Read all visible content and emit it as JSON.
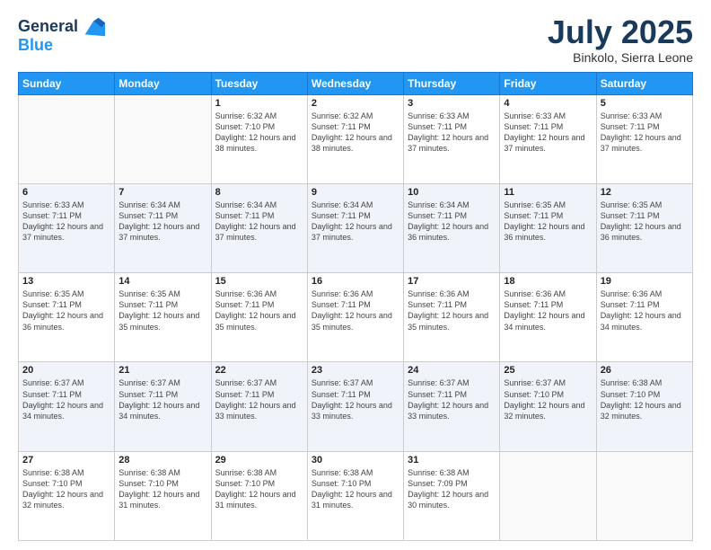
{
  "header": {
    "logo_line1": "General",
    "logo_line2": "Blue",
    "month": "July 2025",
    "location": "Binkolo, Sierra Leone"
  },
  "weekdays": [
    "Sunday",
    "Monday",
    "Tuesday",
    "Wednesday",
    "Thursday",
    "Friday",
    "Saturday"
  ],
  "weeks": [
    [
      {
        "day": "",
        "sunrise": "",
        "sunset": "",
        "daylight": ""
      },
      {
        "day": "",
        "sunrise": "",
        "sunset": "",
        "daylight": ""
      },
      {
        "day": "1",
        "sunrise": "Sunrise: 6:32 AM",
        "sunset": "Sunset: 7:10 PM",
        "daylight": "Daylight: 12 hours and 38 minutes."
      },
      {
        "day": "2",
        "sunrise": "Sunrise: 6:32 AM",
        "sunset": "Sunset: 7:11 PM",
        "daylight": "Daylight: 12 hours and 38 minutes."
      },
      {
        "day": "3",
        "sunrise": "Sunrise: 6:33 AM",
        "sunset": "Sunset: 7:11 PM",
        "daylight": "Daylight: 12 hours and 37 minutes."
      },
      {
        "day": "4",
        "sunrise": "Sunrise: 6:33 AM",
        "sunset": "Sunset: 7:11 PM",
        "daylight": "Daylight: 12 hours and 37 minutes."
      },
      {
        "day": "5",
        "sunrise": "Sunrise: 6:33 AM",
        "sunset": "Sunset: 7:11 PM",
        "daylight": "Daylight: 12 hours and 37 minutes."
      }
    ],
    [
      {
        "day": "6",
        "sunrise": "Sunrise: 6:33 AM",
        "sunset": "Sunset: 7:11 PM",
        "daylight": "Daylight: 12 hours and 37 minutes."
      },
      {
        "day": "7",
        "sunrise": "Sunrise: 6:34 AM",
        "sunset": "Sunset: 7:11 PM",
        "daylight": "Daylight: 12 hours and 37 minutes."
      },
      {
        "day": "8",
        "sunrise": "Sunrise: 6:34 AM",
        "sunset": "Sunset: 7:11 PM",
        "daylight": "Daylight: 12 hours and 37 minutes."
      },
      {
        "day": "9",
        "sunrise": "Sunrise: 6:34 AM",
        "sunset": "Sunset: 7:11 PM",
        "daylight": "Daylight: 12 hours and 37 minutes."
      },
      {
        "day": "10",
        "sunrise": "Sunrise: 6:34 AM",
        "sunset": "Sunset: 7:11 PM",
        "daylight": "Daylight: 12 hours and 36 minutes."
      },
      {
        "day": "11",
        "sunrise": "Sunrise: 6:35 AM",
        "sunset": "Sunset: 7:11 PM",
        "daylight": "Daylight: 12 hours and 36 minutes."
      },
      {
        "day": "12",
        "sunrise": "Sunrise: 6:35 AM",
        "sunset": "Sunset: 7:11 PM",
        "daylight": "Daylight: 12 hours and 36 minutes."
      }
    ],
    [
      {
        "day": "13",
        "sunrise": "Sunrise: 6:35 AM",
        "sunset": "Sunset: 7:11 PM",
        "daylight": "Daylight: 12 hours and 36 minutes."
      },
      {
        "day": "14",
        "sunrise": "Sunrise: 6:35 AM",
        "sunset": "Sunset: 7:11 PM",
        "daylight": "Daylight: 12 hours and 35 minutes."
      },
      {
        "day": "15",
        "sunrise": "Sunrise: 6:36 AM",
        "sunset": "Sunset: 7:11 PM",
        "daylight": "Daylight: 12 hours and 35 minutes."
      },
      {
        "day": "16",
        "sunrise": "Sunrise: 6:36 AM",
        "sunset": "Sunset: 7:11 PM",
        "daylight": "Daylight: 12 hours and 35 minutes."
      },
      {
        "day": "17",
        "sunrise": "Sunrise: 6:36 AM",
        "sunset": "Sunset: 7:11 PM",
        "daylight": "Daylight: 12 hours and 35 minutes."
      },
      {
        "day": "18",
        "sunrise": "Sunrise: 6:36 AM",
        "sunset": "Sunset: 7:11 PM",
        "daylight": "Daylight: 12 hours and 34 minutes."
      },
      {
        "day": "19",
        "sunrise": "Sunrise: 6:36 AM",
        "sunset": "Sunset: 7:11 PM",
        "daylight": "Daylight: 12 hours and 34 minutes."
      }
    ],
    [
      {
        "day": "20",
        "sunrise": "Sunrise: 6:37 AM",
        "sunset": "Sunset: 7:11 PM",
        "daylight": "Daylight: 12 hours and 34 minutes."
      },
      {
        "day": "21",
        "sunrise": "Sunrise: 6:37 AM",
        "sunset": "Sunset: 7:11 PM",
        "daylight": "Daylight: 12 hours and 34 minutes."
      },
      {
        "day": "22",
        "sunrise": "Sunrise: 6:37 AM",
        "sunset": "Sunset: 7:11 PM",
        "daylight": "Daylight: 12 hours and 33 minutes."
      },
      {
        "day": "23",
        "sunrise": "Sunrise: 6:37 AM",
        "sunset": "Sunset: 7:11 PM",
        "daylight": "Daylight: 12 hours and 33 minutes."
      },
      {
        "day": "24",
        "sunrise": "Sunrise: 6:37 AM",
        "sunset": "Sunset: 7:11 PM",
        "daylight": "Daylight: 12 hours and 33 minutes."
      },
      {
        "day": "25",
        "sunrise": "Sunrise: 6:37 AM",
        "sunset": "Sunset: 7:10 PM",
        "daylight": "Daylight: 12 hours and 32 minutes."
      },
      {
        "day": "26",
        "sunrise": "Sunrise: 6:38 AM",
        "sunset": "Sunset: 7:10 PM",
        "daylight": "Daylight: 12 hours and 32 minutes."
      }
    ],
    [
      {
        "day": "27",
        "sunrise": "Sunrise: 6:38 AM",
        "sunset": "Sunset: 7:10 PM",
        "daylight": "Daylight: 12 hours and 32 minutes."
      },
      {
        "day": "28",
        "sunrise": "Sunrise: 6:38 AM",
        "sunset": "Sunset: 7:10 PM",
        "daylight": "Daylight: 12 hours and 31 minutes."
      },
      {
        "day": "29",
        "sunrise": "Sunrise: 6:38 AM",
        "sunset": "Sunset: 7:10 PM",
        "daylight": "Daylight: 12 hours and 31 minutes."
      },
      {
        "day": "30",
        "sunrise": "Sunrise: 6:38 AM",
        "sunset": "Sunset: 7:10 PM",
        "daylight": "Daylight: 12 hours and 31 minutes."
      },
      {
        "day": "31",
        "sunrise": "Sunrise: 6:38 AM",
        "sunset": "Sunset: 7:09 PM",
        "daylight": "Daylight: 12 hours and 30 minutes."
      },
      {
        "day": "",
        "sunrise": "",
        "sunset": "",
        "daylight": ""
      },
      {
        "day": "",
        "sunrise": "",
        "sunset": "",
        "daylight": ""
      }
    ]
  ]
}
